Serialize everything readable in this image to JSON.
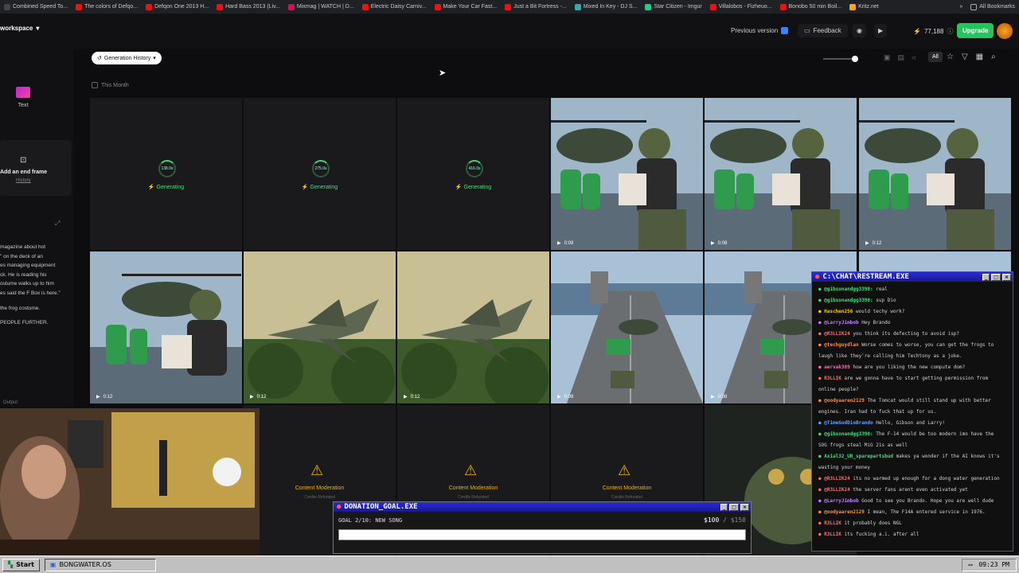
{
  "bookmarks": [
    "Combined Speed To...",
    "The colors of Defqo...",
    "Defqon One 2013 H...",
    "Hard Bass 2013 (Liv...",
    "Mixmag | WATCH | D...",
    "Electric Daisy Carniv...",
    "Make Your Car Fast...",
    "Just a Bit Fortress -...",
    "Mixed In Key - DJ S...",
    "Star Citizen - Imgur",
    "Villalobos - Fizheuo...",
    "Bonobo 50 min Boil...",
    "Kritz.net"
  ],
  "bookmarks_all": "All Bookmarks",
  "header": {
    "workspace": "workspace",
    "previous_version": "Previous version",
    "feedback": "Feedback",
    "credits": "77,188",
    "upgrade": "Upgrade"
  },
  "sidebar": {
    "text_label": "Text",
    "end_frame_label": "Add an end frame",
    "history_link": "History",
    "prompt_lines": [
      "magazine about hot",
      "\" on the deck of an",
      "es managing equipment",
      "ck. He is reading his",
      "ostume walks up to him",
      "es said the F Box is here.\"",
      "the frog costume.",
      "PEOPLE FURTHER."
    ],
    "output_label": "Output"
  },
  "toolbar": {
    "history_button": "Generation History",
    "filter_all": "All",
    "section_label": "This Month"
  },
  "generating": [
    {
      "timer": "138.0s",
      "label": "Generating"
    },
    {
      "timer": "275.0s",
      "label": "Generating"
    },
    {
      "timer": "416.0s",
      "label": "Generating"
    }
  ],
  "durations": {
    "r1c4": "0:08",
    "r1c5": "0:08",
    "r1c6": "0:12",
    "r2c1": "0:12",
    "r2c2": "0:12",
    "r2c3": "0:12",
    "r2c4": "0:08",
    "r2c5": "0:08"
  },
  "moderation": {
    "label": "Content Moderation",
    "sub": "Credits Refunded"
  },
  "chat": {
    "title": "C:\\CHAT\\RESTREAM.EXE",
    "messages": [
      {
        "user": "@gibsonandgg3390:",
        "text": "real",
        "color": "#4ade80"
      },
      {
        "user": "@gibsonandgg3390:",
        "text": "sup Dio",
        "color": "#4ade80"
      },
      {
        "user": "Haschen256",
        "text": "would techy work?",
        "color": "#facc15"
      },
      {
        "user": "@LarryJimbob",
        "text": "Hey Brando",
        "color": "#c084fc"
      },
      {
        "user": "@R3LLIK24",
        "text": "you think its defecting to avoid isp?",
        "color": "#f87171"
      },
      {
        "user": "@techguydlan",
        "text": "Worse comes to worse, you can get the frogs to",
        "color": "#fb923c"
      },
      {
        "user": "",
        "text": "laugh like they're calling him Techtony as a joke.",
        "color": "#d4d4d4"
      },
      {
        "user": "aervak389",
        "text": "how are you liking the new compute dom?",
        "color": "#f472b6"
      },
      {
        "user": "R3LLIK",
        "text": "are we gonna have to start getting permission from",
        "color": "#f87171"
      },
      {
        "user": "",
        "text": "online people?",
        "color": "#d4d4d4"
      },
      {
        "user": "@oodyaaren2129",
        "text": "The Tomcat would still stand up with better",
        "color": "#fb923c"
      },
      {
        "user": "",
        "text": "engines. Iran had to fuck that up for us.",
        "color": "#d4d4d4"
      },
      {
        "user": "@TimeGodDioBrando",
        "text": "Hello, Gibson and Larry!",
        "color": "#60a5fa"
      },
      {
        "user": "@gibsonandgg3390:",
        "text": "The F-14 would be too modern imo have the",
        "color": "#4ade80"
      },
      {
        "user": "",
        "text": "SOG frogs steal MiG 21s as well",
        "color": "#d4d4d4"
      },
      {
        "user": "Axial32_UR_sparepartsbud",
        "text": "makes ya wonder if the AI knows it's",
        "color": "#4ade80"
      },
      {
        "user": "",
        "text": "wasting your money",
        "color": "#d4d4d4"
      },
      {
        "user": "@R3LLIK24",
        "text": "its no warmed up enough for a dong water generation",
        "color": "#f87171"
      },
      {
        "user": "@R3LLIK24",
        "text": "the server fans arent even activated yet",
        "color": "#f87171"
      },
      {
        "user": "@LarryJimbob",
        "text": "Good to see you Brando. Hope you are well dude",
        "color": "#c084fc"
      },
      {
        "user": "@oodyaaren2129",
        "text": "I mean, The F14A entered service in 1976.",
        "color": "#fb923c"
      },
      {
        "user": "R3LLIK",
        "text": "it probably does NGL",
        "color": "#f87171"
      },
      {
        "user": "R3LLIK",
        "text": "its fucking a.i. after all",
        "color": "#f87171"
      }
    ]
  },
  "donation": {
    "title": "DONATION_GOAL.EXE",
    "goal": "GOAL 2/10: NEW SONG",
    "amount": "$100",
    "target": "/ $150",
    "progress": 0.67
  },
  "taskbar": {
    "start": "Start",
    "app": "BONGWATER.OS",
    "clock": "09:23 PM"
  }
}
